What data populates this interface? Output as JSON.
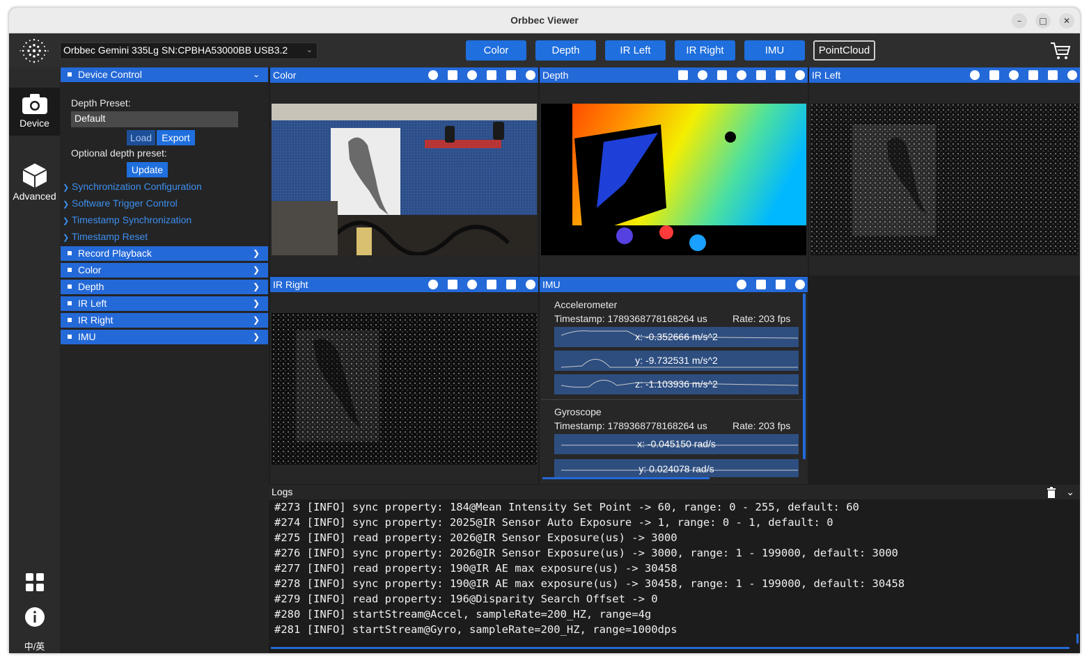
{
  "window": {
    "title": "Orbbec Viewer"
  },
  "toolbar": {
    "device": "Orbbec Gemini 335Lg SN:CPBHA53000BB USB3.2",
    "buttons": [
      "Color",
      "Depth",
      "IR Left",
      "IR Right",
      "IMU",
      "PointCloud"
    ]
  },
  "nav": {
    "device": "Device",
    "advanced": "Advanced",
    "lang": "中/英"
  },
  "side": {
    "device_control": "Device Control",
    "depth_preset_label": "Depth Preset:",
    "depth_preset_value": "Default",
    "load": "Load",
    "export": "Export",
    "optional_label": "Optional depth preset:",
    "update": "Update",
    "links": [
      "Synchronization Configuration",
      "Software Trigger Control",
      "Timestamp Synchronization",
      "Timestamp Reset"
    ],
    "sections": [
      "Record Playback",
      "Color",
      "Depth",
      "IR Left",
      "IR Right",
      "IMU"
    ]
  },
  "panels": {
    "color": "Color",
    "depth": "Depth",
    "ir_left": "IR Left",
    "ir_right": "IR Right",
    "imu": "IMU"
  },
  "imu": {
    "accel": {
      "title": "Accelerometer",
      "timestamp": "Timestamp: 1789368778168264 us",
      "rate": "Rate: 203 fps",
      "x": "x: -0.352666 m/s^2",
      "y": "y: -9.732531 m/s^2",
      "z": "z: -1.103936 m/s^2"
    },
    "gyro": {
      "title": "Gyroscope",
      "timestamp": "Timestamp: 1789368778168264 us",
      "rate": "Rate: 203 fps",
      "x": "x: -0.045150 rad/s",
      "y": "y: 0.024078 rad/s"
    }
  },
  "logs": {
    "title": "Logs",
    "lines": [
      "#273 [INFO] sync property: 184@Mean Intensity Set Point -> 60, range: 0 - 255, default: 60",
      "#274 [INFO] sync property: 2025@IR Sensor Auto Exposure -> 1, range: 0 - 1, default: 0",
      "#275 [INFO] read property: 2026@IR Sensor Exposure(us) -> 3000",
      "#276 [INFO] sync property: 2026@IR Sensor Exposure(us) -> 3000, range: 1 - 199000, default: 3000",
      "#277 [INFO] read property: 190@IR AE max exposure(us) -> 30458",
      "#278 [INFO] sync property: 190@IR AE max exposure(us) -> 30458, range: 1 - 199000, default: 30458",
      "#279 [INFO] read property: 196@Disparity Search Offset -> 0",
      "#280 [INFO] startStream@Accel, sampleRate=200_HZ, range=4g",
      "#281 [INFO] startStream@Gyro, sampleRate=200_HZ, range=1000dps"
    ]
  },
  "icons": [
    "minimize-icon",
    "maximize-icon",
    "close-icon",
    "cart-icon",
    "camera-icon",
    "cube-icon",
    "grid-icon",
    "info-icon",
    "trash-icon",
    "chevron-down-icon"
  ]
}
